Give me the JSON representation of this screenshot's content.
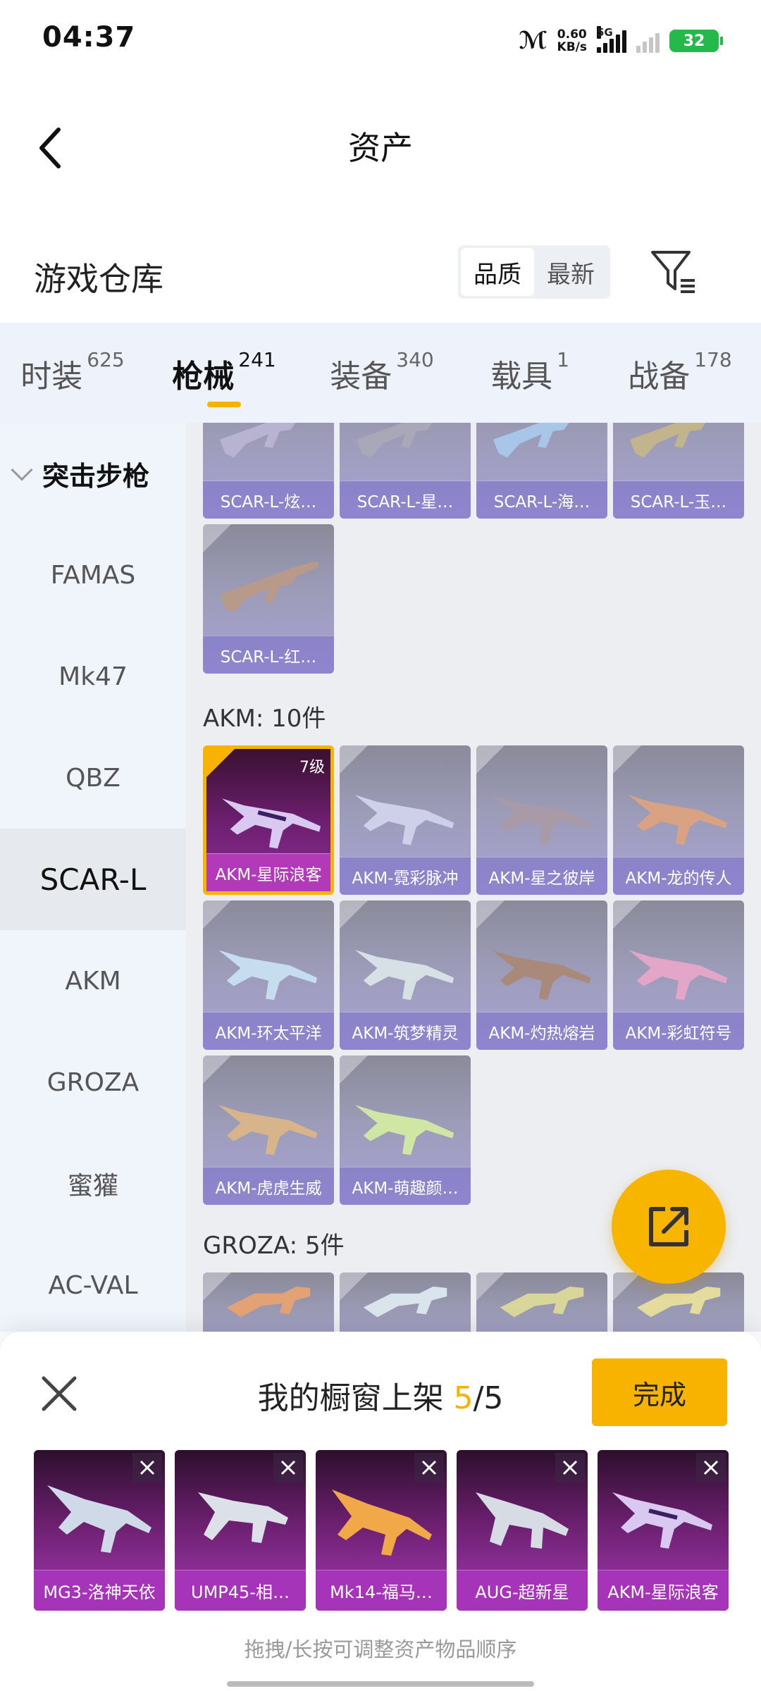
{
  "status": {
    "time": "04:37",
    "speed_value": "0.60",
    "speed_unit": "KB/s",
    "network": "5G",
    "battery": "32"
  },
  "header": {
    "title": "资产"
  },
  "warehouse": {
    "title": "游戏仓库",
    "sort_options": [
      "品质",
      "最新"
    ],
    "sort_selected": "品质"
  },
  "tabs": [
    {
      "label": "时装",
      "count": "625"
    },
    {
      "label": "枪械",
      "count": "241",
      "active": true
    },
    {
      "label": "装备",
      "count": "340"
    },
    {
      "label": "载具",
      "count": "1"
    },
    {
      "label": "战备",
      "count": "178"
    }
  ],
  "sidebar": {
    "group": "突击步枪",
    "items": [
      "FAMAS",
      "Mk47",
      "QBZ",
      "SCAR-L",
      "AKM",
      "GROZA",
      "蜜獾",
      "AC-VAL"
    ],
    "selected": "SCAR-L"
  },
  "content": {
    "scar_top_row": [
      "SCAR-L-炫…",
      "SCAR-L-星…",
      "SCAR-L-海…",
      "SCAR-L-玉…"
    ],
    "scar_extra": [
      "SCAR-L-红…"
    ],
    "akm_section": "AKM: 10件",
    "akm_items": [
      {
        "name": "AKM-星际浪客",
        "level": "7级",
        "selected": true
      },
      {
        "name": "AKM-霓彩脉冲"
      },
      {
        "name": "AKM-星之彼岸"
      },
      {
        "name": "AKM-龙的传人"
      },
      {
        "name": "AKM-环太平洋"
      },
      {
        "name": "AKM-筑梦精灵"
      },
      {
        "name": "AKM-灼热熔岩"
      },
      {
        "name": "AKM-彩虹符号"
      },
      {
        "name": "AKM-虎虎生威"
      },
      {
        "name": "AKM-萌趣颜…"
      }
    ],
    "groza_section": "GROZA: 5件"
  },
  "sheet": {
    "title_prefix": "我的橱窗上架",
    "count_current": "5",
    "count_sep": "/",
    "count_total": "5",
    "done_label": "完成",
    "items": [
      "MG3-洛神天依",
      "UMP45-相…",
      "Mk14-福马…",
      "AUG-超新星",
      "AKM-星际浪客"
    ],
    "hint": "拖拽/长按可调整资产物品顺序"
  },
  "icons": {
    "back": "back-arrow-icon",
    "filter": "filter-icon",
    "share": "share-external-icon",
    "close": "close-icon"
  },
  "colors": {
    "accent": "#f5b300",
    "selected_card": "#8e2d99",
    "tab_bg": "#eef2fa"
  }
}
